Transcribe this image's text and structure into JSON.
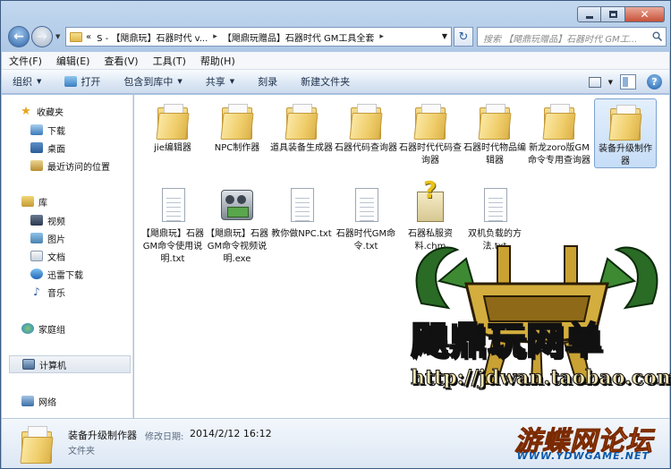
{
  "window": {
    "min_label": "",
    "close_glyph": "✕"
  },
  "nav": {
    "breadcrumbs": [
      "S - 【飓鼎玩】石器时代 v...",
      "【飓鼎玩赠品】石器时代 GM工具全套"
    ],
    "lead": "«",
    "search_placeholder": "搜索 【飓鼎玩赠品】石器时代 GM工..."
  },
  "menubar": [
    "文件(F)",
    "编辑(E)",
    "查看(V)",
    "工具(T)",
    "帮助(H)"
  ],
  "commandbar": {
    "organize": "组织",
    "open": "打开",
    "include": "包含到库中",
    "share": "共享",
    "burn": "刻录",
    "new_folder": "新建文件夹"
  },
  "sidebar": {
    "favorites": "收藏夹",
    "downloads": "下载",
    "desktop": "桌面",
    "recent": "最近访问的位置",
    "libraries": "库",
    "videos": "视频",
    "pictures": "图片",
    "documents": "文档",
    "thunder": "迅雷下载",
    "music": "音乐",
    "homegroup": "家庭组",
    "computer": "计算机",
    "network": "网络"
  },
  "files": [
    {
      "name": "jie编辑器",
      "type": "folder"
    },
    {
      "name": "NPC制作器",
      "type": "folder"
    },
    {
      "name": "道具装备生成器",
      "type": "folder"
    },
    {
      "name": "石器代码查询器",
      "type": "folder"
    },
    {
      "name": "石器时代代码查询器",
      "type": "folder"
    },
    {
      "name": "石器时代物品编辑器",
      "type": "folder"
    },
    {
      "name": "新龙zoro版GM命令专用查询器",
      "type": "folder"
    },
    {
      "name": "装备升级制作器",
      "type": "folder",
      "selected": true
    },
    {
      "name": "【飓鼎玩】石器GM命令使用说明.txt",
      "type": "txt"
    },
    {
      "name": "【飓鼎玩】石器GM命令视频说明.exe",
      "type": "exe"
    },
    {
      "name": "教你做NPC.txt",
      "type": "txt"
    },
    {
      "name": "石器时代GM命令.txt",
      "type": "txt"
    },
    {
      "name": "石器私服资料.chm",
      "type": "chm"
    },
    {
      "name": "双机负载的方法.txt",
      "type": "txt"
    }
  ],
  "watermark": {
    "title": "飓鼎玩网单",
    "url": "http://jdwan.taobao.com"
  },
  "details": {
    "name": "装备升级制作器",
    "modified_label": "修改日期:",
    "modified": "2014/2/12 16:12",
    "type": "文件夹"
  },
  "corner_logo": {
    "title": "游蝶网论坛",
    "sub": "WWW.YDWGAME.NET"
  },
  "colors": {
    "accent": "#2d63a6",
    "selection": "#c6ddf7",
    "logo_orange": "#ff7a1a"
  }
}
